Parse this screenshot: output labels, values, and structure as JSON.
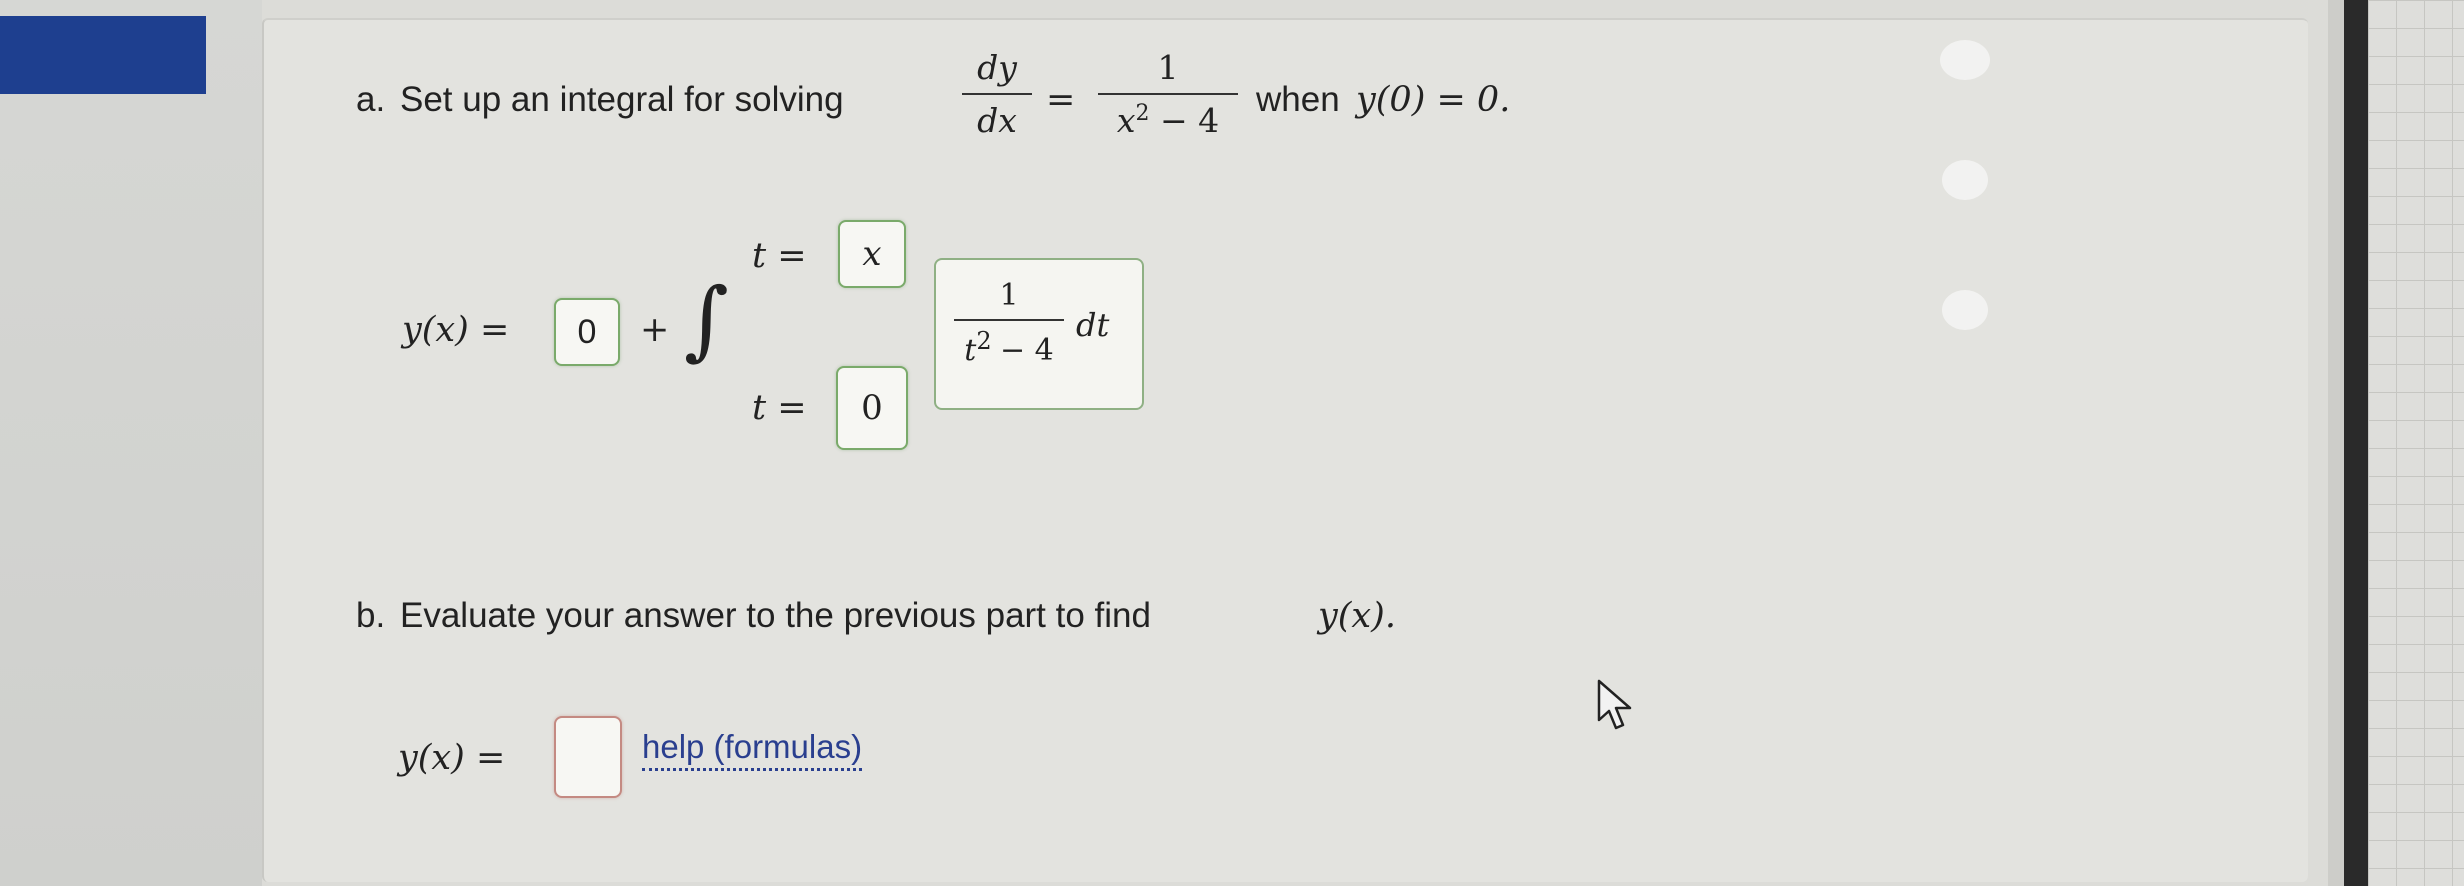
{
  "part_a": {
    "label": "a.",
    "prompt": "Set up an integral for solving",
    "dy": "dy",
    "dx": "dx",
    "eq": "=",
    "rhs_num": "1",
    "rhs_den": "x",
    "rhs_den_exp": "2",
    "rhs_den_tail": " − 4",
    "when_text": "when",
    "condition": "y(0) = 0.",
    "lhs": "y(x) =",
    "const_value": "0",
    "plus": "+",
    "integral_sign": "∫",
    "upper_label": "t =",
    "upper_value": "x",
    "lower_label": "t =",
    "lower_value": "0",
    "integrand_num": "1",
    "integrand_den_base": "t",
    "integrand_den_exp": "2",
    "integrand_den_tail": "− 4",
    "integrand_dt": "dt"
  },
  "part_b": {
    "label": "b.",
    "prompt": "Evaluate your answer to the previous part to find",
    "target": "y(x).",
    "lhs": "y(x) =",
    "answer_value": "",
    "help_link": "help (formulas)"
  },
  "colors": {
    "blue_tab": "#1e3f8f",
    "correct_border": "#7aaa6a",
    "empty_border": "#c48a82",
    "link": "#2a3f8f"
  }
}
